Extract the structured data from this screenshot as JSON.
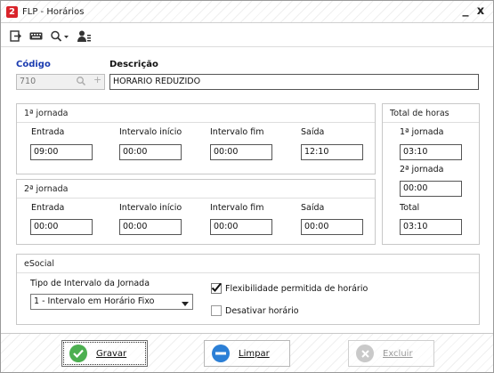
{
  "window": {
    "title": "FLP - Horários",
    "minimize": "_",
    "close": "x",
    "app_icon": "2"
  },
  "toolbar": {
    "icons": [
      "exit-icon",
      "keyboard-icon",
      "search-icon",
      "user-icon"
    ]
  },
  "header": {
    "codigo_label": "Código",
    "codigo_value": "710",
    "descricao_label": "Descrição",
    "descricao_value": "HORARIO REDUZIDO"
  },
  "jornada1": {
    "title": "1ª jornada",
    "entrada_label": "Entrada",
    "entrada": "09:00",
    "int_inicio_label": "Intervalo início",
    "int_inicio": "00:00",
    "int_fim_label": "Intervalo fim",
    "int_fim": "00:00",
    "saida_label": "Saída",
    "saida": "12:10"
  },
  "jornada2": {
    "title": "2ª jornada",
    "entrada_label": "Entrada",
    "entrada": "00:00",
    "int_inicio_label": "Intervalo início",
    "int_inicio": "00:00",
    "int_fim_label": "Intervalo fim",
    "int_fim": "00:00",
    "saida_label": "Saída",
    "saida": "00:00"
  },
  "totais": {
    "title": "Total de horas",
    "j1_label": "1ª jornada",
    "j1": "03:10",
    "j2_label": "2ª jornada",
    "j2": "00:00",
    "total_label": "Total",
    "total": "03:10"
  },
  "esocial": {
    "title": "eSocial",
    "tipo_label": "Tipo de Intervalo da Jornada",
    "tipo_value": "1 - Intervalo em Horário Fixo",
    "flex_label": "Flexibilidade permitida de horário",
    "flex_checked": true,
    "desativar_label": "Desativar horário",
    "desativar_checked": false
  },
  "footer": {
    "gravar": "Gravar",
    "limpar": "Limpar",
    "excluir": "Excluir"
  },
  "colors": {
    "accent_blue": "#1a3bb0",
    "gravar_green": "#4caf50",
    "limpar_blue": "#2b7fd6",
    "excluir_gray": "#c9c9c9"
  }
}
